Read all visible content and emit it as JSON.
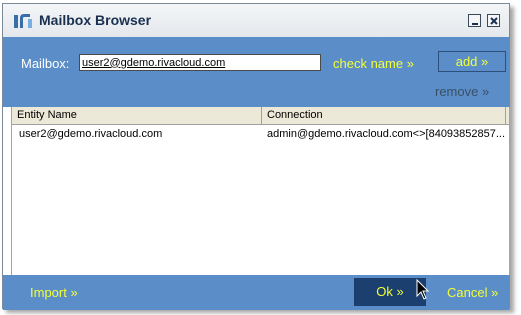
{
  "window": {
    "title": "Mailbox Browser"
  },
  "mailbox": {
    "label": "Mailbox:",
    "value": "user2@gdemo.rivacloud.com",
    "check_name": "check name »",
    "add": "add »",
    "remove": "remove »"
  },
  "grid": {
    "columns": [
      "Entity Name",
      "Connection"
    ],
    "rows": [
      {
        "entity": "user2@gdemo.rivacloud.com",
        "connection": "admin@gdemo.rivacloud.com<>[84093852857..."
      }
    ]
  },
  "footer": {
    "import": "Import »",
    "ok": "Ok »",
    "cancel": "Cancel »"
  },
  "colors": {
    "panel": "#5b8ec9",
    "accent_text": "#f2ff3a",
    "ok_button": "#1b3f6e"
  },
  "icons": [
    "app-logo-icon",
    "minimize-icon",
    "close-icon",
    "mouse-cursor-icon"
  ]
}
